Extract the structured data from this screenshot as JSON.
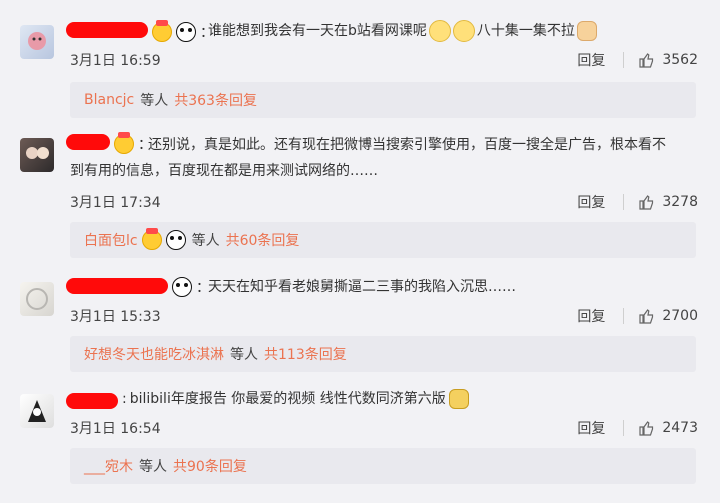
{
  "comments": [
    {
      "text": "谁能想到我会有一天在b站看网课呢",
      "text_tail": "八十集一集不拉",
      "time": "3月1日 16:59",
      "reply_label": "回复",
      "likes": "3562",
      "thread": {
        "name": "Blancjc",
        "mid": "等人",
        "count": "共363条回复"
      }
    },
    {
      "text": "还别说，真是如此。还有现在把微博当搜索引擎使用，百度一搜全是广告，根本看不",
      "text_line2": "到有用的信息，百度现在都是用来测试网络的……",
      "time": "3月1日 17:34",
      "reply_label": "回复",
      "likes": "3278",
      "thread": {
        "name": "白面包lc",
        "mid": "等人",
        "count": "共60条回复"
      }
    },
    {
      "text": "天天在知乎看老娘舅撕逼二三事的我陷入沉思……",
      "time": "3月1日 15:33",
      "reply_label": "回复",
      "likes": "2700",
      "thread": {
        "name": "好想冬天也能吃冰淇淋",
        "mid": "等人",
        "count": "共113条回复"
      }
    },
    {
      "text": "bilibili年度报告 你最爱的视频 线性代数同济第六版",
      "time": "3月1日 16:54",
      "reply_label": "回复",
      "likes": "2473",
      "thread": {
        "name": "___宛木",
        "mid": "等人",
        "count": "共90条回复"
      }
    }
  ],
  "icons": {
    "like": "thumb-up-icon",
    "vip": "crown-emoji",
    "panda": "panda-emoji",
    "smile": "smile-emoji",
    "fist": "fist-emoji"
  },
  "colors": {
    "accent": "#eb7350",
    "redaction": "#ff0a0a",
    "background": "#f2f2f5"
  }
}
